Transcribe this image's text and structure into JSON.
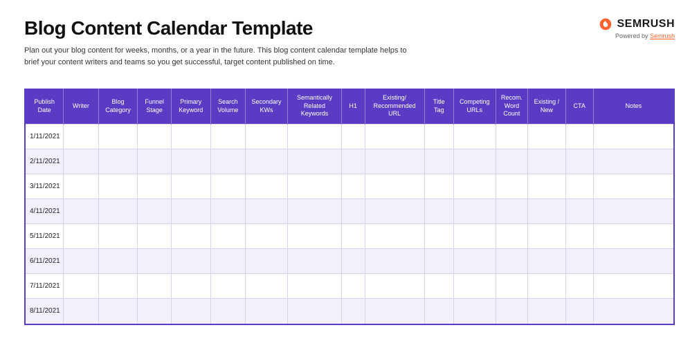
{
  "header": {
    "title": "Blog Content Calendar Template",
    "brand_name": "SEMRUSH",
    "powered_by_prefix": "Powered by ",
    "powered_by_link": "Semrush"
  },
  "description": "Plan out your blog content for weeks, months, or a year in the future. This blog content calendar template helps to brief your content writers and teams so you get successful, target content published on time.",
  "table": {
    "columns": [
      "Publish Date",
      "Writer",
      "Blog Category",
      "Funnel Stage",
      "Primary Keyword",
      "Search Volume",
      "Secondary KWs",
      "Semantically Related Keywords",
      "H1",
      "Existing/ Recommended URL",
      "Title Tag",
      "Competing URLs",
      "Recom. Word Count",
      "Existing / New",
      "CTA",
      "Notes"
    ],
    "rows": [
      {
        "publish_date": "1/11/2021"
      },
      {
        "publish_date": "2/11/2021"
      },
      {
        "publish_date": "3/11/2021"
      },
      {
        "publish_date": "4/11/2021"
      },
      {
        "publish_date": "5/11/2021"
      },
      {
        "publish_date": "6/11/2021"
      },
      {
        "publish_date": "7/11/2021"
      },
      {
        "publish_date": "8/11/2021"
      }
    ]
  }
}
